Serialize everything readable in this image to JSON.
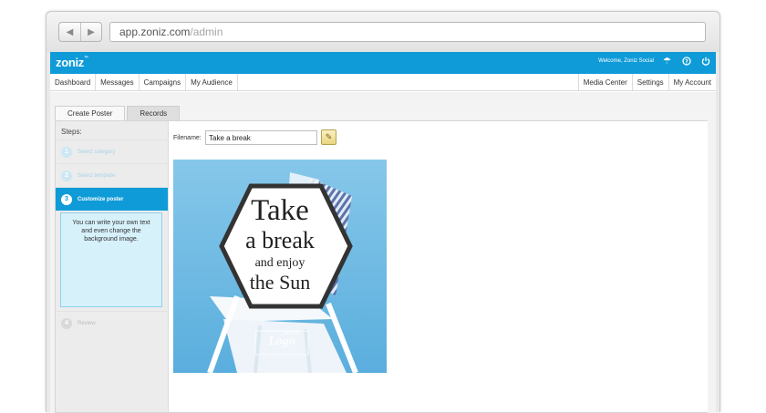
{
  "browser": {
    "url_host": "app.zoniz.com",
    "url_path": "/admin"
  },
  "app": {
    "logo": "zoniz",
    "logo_tm": "™",
    "welcome": "Welcome, Zoniz Social"
  },
  "nav": {
    "left": [
      "Dashboard",
      "Messages",
      "Campaigns",
      "My Audience"
    ],
    "right": [
      "Media Center",
      "Settings",
      "My Account"
    ]
  },
  "tabs": [
    "Create Poster",
    "Records"
  ],
  "steps": {
    "title": "Steps:",
    "items": [
      {
        "num": "1",
        "label": "Select category"
      },
      {
        "num": "2",
        "label": "Select template"
      },
      {
        "num": "3",
        "label": "Customize poster"
      },
      {
        "num": "4",
        "label": "Review"
      }
    ],
    "help": "You can write your own text and even change the background image."
  },
  "editor": {
    "filename_label": "Filename:",
    "filename_value": "Take a break"
  },
  "poster": {
    "line1": "Take",
    "line2": "a break",
    "line3": "and enjoy",
    "line4": "the Sun",
    "logo_text": "Logo",
    "logo_size": "150 x 50"
  },
  "colors": {
    "brand": "#0f9bd7",
    "help_bg": "#d7f1fb",
    "poster_bg": "#7ec1e6"
  },
  "icons": {
    "back": "arrow-left-icon",
    "forward": "arrow-right-icon",
    "umbrella": "umbrella-icon",
    "help": "help-icon",
    "power": "power-icon",
    "edit": "pencil-icon"
  }
}
